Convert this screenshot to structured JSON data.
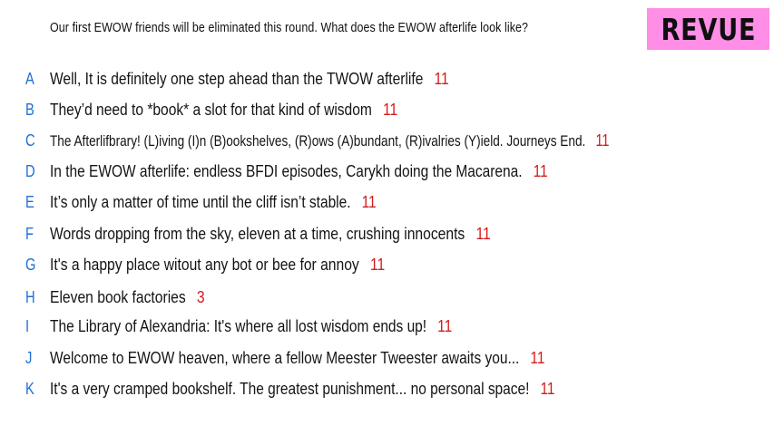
{
  "prompt": "Our first EWOW friends will be eliminated this round. What does the EWOW afterlife look like?",
  "badge": "REVUE",
  "colors": {
    "badge_bg": "#ff8ee6",
    "letter": "#1f6fd6",
    "score": "#d61919"
  },
  "responses": [
    {
      "letter": "A",
      "text": "Well, It is definitely one step ahead than the TWOW afterlife",
      "score": "11"
    },
    {
      "letter": "B",
      "text": "They’d need to *book* a slot for that kind of wisdom",
      "score": "11"
    },
    {
      "letter": "C",
      "text": "The Afterlifbrary!  (L)iving (I)n (B)ookshelves, (R)ows (A)bundant, (R)ivalries (Y)ield. Journeys End.",
      "score": "11"
    },
    {
      "letter": "D",
      "text": "In the EWOW afterlife: endless BFDI episodes, Carykh doing the Macarena.",
      "score": "11"
    },
    {
      "letter": "E",
      "text": "It’s only a matter of time until the cliff isn’t stable.",
      "score": "11"
    },
    {
      "letter": "F",
      "text": "Words dropping from the sky, eleven at a time, crushing innocents",
      "score": "11"
    },
    {
      "letter": "G",
      "text": "It's a  happy place witout any bot or bee for annoy",
      "score": "11"
    },
    {
      "letter": "H",
      "text": "Eleven book factories",
      "score": "3"
    },
    {
      "letter": "I",
      "text": "The Library of Alexandria: It's where all lost wisdom ends up!",
      "score": "11"
    },
    {
      "letter": "J",
      "text": "Welcome to EWOW heaven, where a fellow Meester Tweester awaits you...",
      "score": "11"
    },
    {
      "letter": "K",
      "text": "It's a very cramped bookshelf. The greatest punishment... no personal space!",
      "score": "11"
    }
  ]
}
